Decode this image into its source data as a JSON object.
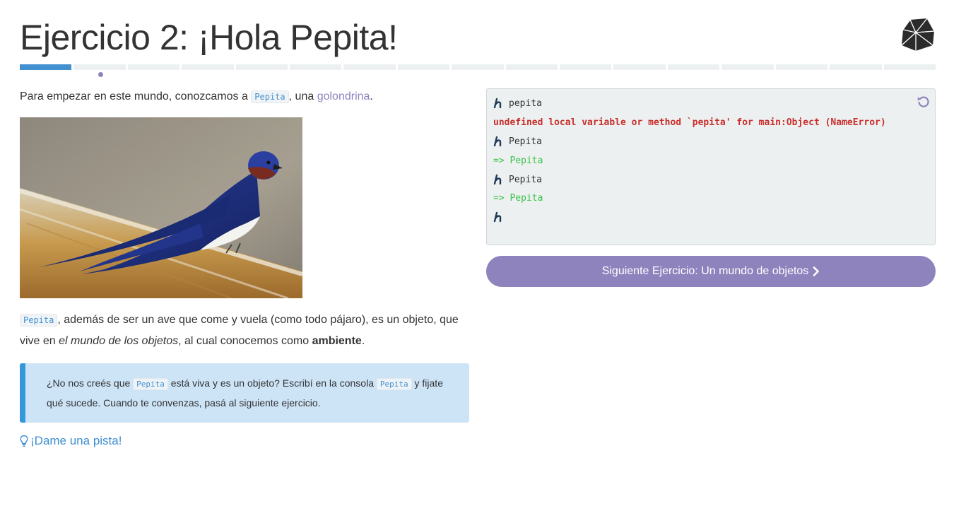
{
  "header": {
    "title": "Ejercicio 2: ¡Hola Pepita!",
    "logo_icon": "ruby-gem-icon"
  },
  "progress": {
    "segments": 17,
    "current": 1
  },
  "content": {
    "intro_prefix": "Para empezar en este mundo, conozcamos a ",
    "intro_code": "Pepita",
    "intro_middle": ", una ",
    "intro_link": "golondrina",
    "intro_suffix": ".",
    "desc_code": "Pepita",
    "desc_part1": ", además de ser un ave que come y vuela (como todo pájaro), es un objeto, que vive en ",
    "desc_italic": "el mundo de los objetos",
    "desc_part2": ", al cual conocemos como ",
    "desc_bold": "ambiente",
    "desc_end": "."
  },
  "callout": {
    "part1": "¿No nos creés que ",
    "code1": "Pepita",
    "part2": " está viva y es un objeto? Escribí en la consola ",
    "code2": "Pepita",
    "part3": " y fijate qué sucede. Cuando te convenzas, pasá al siguiente ejercicio."
  },
  "hint": {
    "label": "¡Dame una pista!",
    "icon": "lightbulb-icon"
  },
  "console": {
    "reset_icon": "reset-icon",
    "lines": [
      {
        "type": "input",
        "text": "pepita"
      },
      {
        "type": "error",
        "text": "undefined local variable or method `pepita' for main:Object (NameError)"
      },
      {
        "type": "input",
        "text": "Pepita"
      },
      {
        "type": "output",
        "text": "=> Pepita"
      },
      {
        "type": "input",
        "text": "Pepita"
      },
      {
        "type": "output",
        "text": "=> Pepita"
      },
      {
        "type": "input",
        "text": ""
      }
    ]
  },
  "next_button": {
    "label": "Siguiente Ejercicio: Un mundo de objetos",
    "icon": "chevron-right-icon"
  },
  "colors": {
    "accent": "#8f83bd",
    "link_blue": "#3f8fd2",
    "progress_active": "#4190d0",
    "error": "#c9302c",
    "success": "#3cc44a"
  }
}
